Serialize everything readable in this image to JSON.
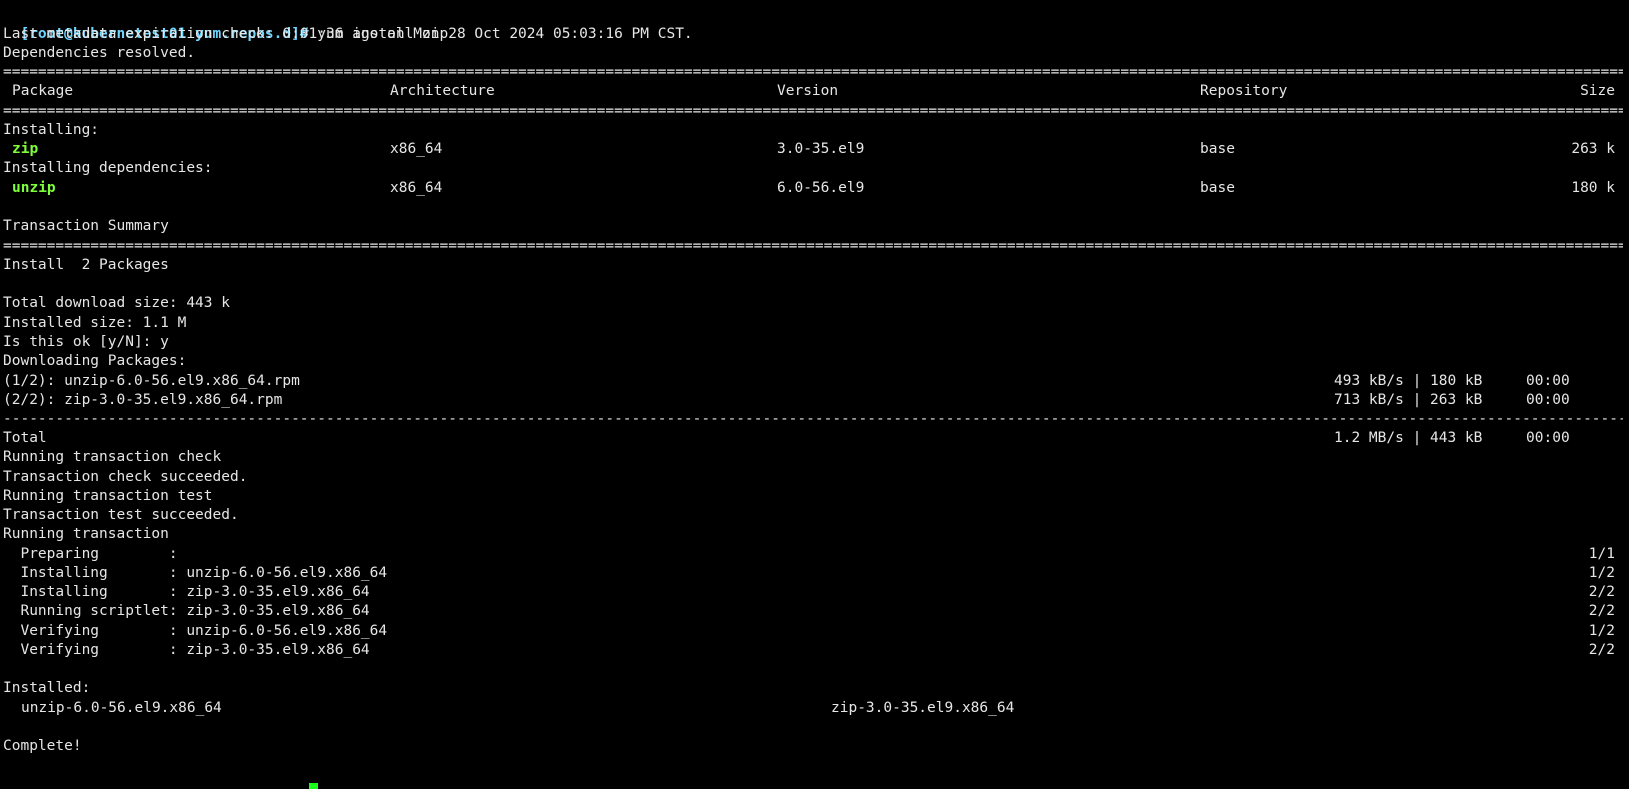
{
  "terminal": {
    "prompt": "[root@kubernetest01 yum.repos.d]#",
    "command": " yum install zip",
    "metadata_line": "Last metadata expiration check: 0:01:36 ago on Mon 28 Oct 2024 05:03:16 PM CST.",
    "deps_resolved": "Dependencies resolved.",
    "rule_double": "==================================================================================================================================================================================================================",
    "rule_dash": "------------------------------------------------------------------------------------------------------------------------------------------------------------------------------------------------------------------",
    "table_headers": {
      "package": "Package",
      "architecture": "Architecture",
      "version": "Version",
      "repository": "Repository",
      "size": "Size"
    },
    "installing_label": "Installing:",
    "installing_deps_label": "Installing dependencies:",
    "packages": [
      {
        "name": "zip",
        "arch": "x86_64",
        "version": "3.0-35.el9",
        "repo": "base",
        "size": "263 k"
      },
      {
        "name": "unzip",
        "arch": "x86_64",
        "version": "6.0-56.el9",
        "repo": "base",
        "size": "180 k"
      }
    ],
    "transaction_summary": "Transaction Summary",
    "install_count": "Install  2 Packages",
    "total_download": "Total download size: 443 k",
    "installed_size": "Installed size: 1.1 M",
    "confirm_prompt": "Is this ok [y/N]: y",
    "downloading": "Downloading Packages:",
    "downloads": [
      {
        "file": "(1/2): unzip-6.0-56.el9.x86_64.rpm",
        "rate": "493 kB/s | 180 kB     00:00"
      },
      {
        "file": "(2/2): zip-3.0-35.el9.x86_64.rpm",
        "rate": "713 kB/s | 263 kB     00:00"
      }
    ],
    "total_label": "Total",
    "total_rate": "1.2 MB/s | 443 kB     00:00",
    "check_lines": [
      "Running transaction check",
      "Transaction check succeeded.",
      "Running transaction test",
      "Transaction test succeeded.",
      "Running transaction"
    ],
    "steps": [
      {
        "text": "  Preparing        :",
        "count": "1/1"
      },
      {
        "text": "  Installing       : unzip-6.0-56.el9.x86_64",
        "count": "1/2"
      },
      {
        "text": "  Installing       : zip-3.0-35.el9.x86_64",
        "count": "2/2"
      },
      {
        "text": "  Running scriptlet: zip-3.0-35.el9.x86_64",
        "count": "2/2"
      },
      {
        "text": "  Verifying        : unzip-6.0-56.el9.x86_64",
        "count": "1/2"
      },
      {
        "text": "  Verifying        : zip-3.0-35.el9.x86_64",
        "count": "2/2"
      }
    ],
    "installed_label": "Installed:",
    "installed_items": [
      "unzip-6.0-56.el9.x86_64",
      "zip-3.0-35.el9.x86_64"
    ],
    "complete": "Complete!"
  }
}
